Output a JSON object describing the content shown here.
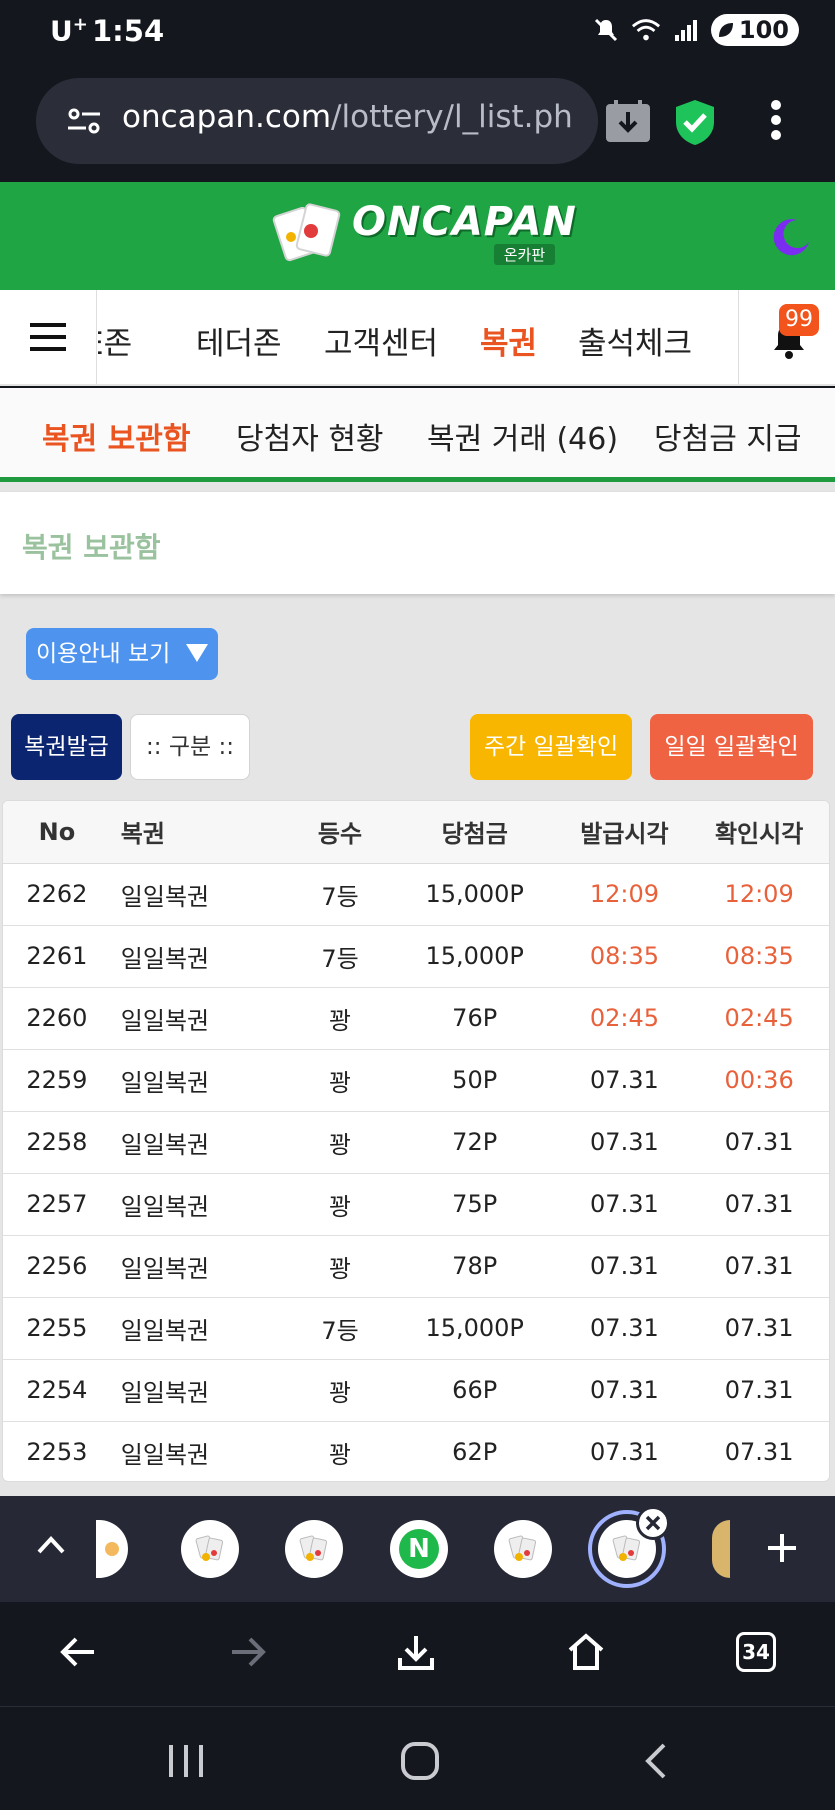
{
  "status_bar": {
    "carrier": "U",
    "carrier_sup": "+",
    "time": "1:54",
    "battery": "100"
  },
  "browser": {
    "url_host": "oncapan.com",
    "url_path": "/lottery/l_list.ph",
    "tab_count": "34"
  },
  "site": {
    "logo_text": "ONCAPAN",
    "logo_sub": "온카판"
  },
  "main_nav": {
    "items": [
      {
        "label": "E존"
      },
      {
        "label": "테더존"
      },
      {
        "label": "고객센터"
      },
      {
        "label": "복권"
      },
      {
        "label": "출석체크"
      }
    ],
    "active_index": 3,
    "notification_count": "99"
  },
  "sub_nav": {
    "items": [
      {
        "label": "복권 보관함"
      },
      {
        "label": "당첨자 현황"
      },
      {
        "label": "복권 거래 (46)"
      },
      {
        "label": "당첨금 지급"
      }
    ],
    "active_index": 0
  },
  "page": {
    "title": "복권 보관함",
    "guide_button": "이용안내 보기",
    "issue_button": "복권발급",
    "category_select": ":: 구분 ::",
    "weekly_check_button": "주간 일괄확인",
    "daily_check_button": "일일 일괄확인"
  },
  "table": {
    "headers": [
      "No",
      "복권",
      "등수",
      "당첨금",
      "발급시각",
      "확인시각"
    ],
    "rows": [
      {
        "no": "2262",
        "name": "일일복권",
        "rank": "7등",
        "prize": "15,000P",
        "issued": "12:09",
        "checked": "12:09"
      },
      {
        "no": "2261",
        "name": "일일복권",
        "rank": "7등",
        "prize": "15,000P",
        "issued": "08:35",
        "checked": "08:35"
      },
      {
        "no": "2260",
        "name": "일일복권",
        "rank": "꽝",
        "prize": "76P",
        "issued": "02:45",
        "checked": "02:45"
      },
      {
        "no": "2259",
        "name": "일일복권",
        "rank": "꽝",
        "prize": "50P",
        "issued": "07.31",
        "checked": "00:36"
      },
      {
        "no": "2258",
        "name": "일일복권",
        "rank": "꽝",
        "prize": "72P",
        "issued": "07.31",
        "checked": "07.31"
      },
      {
        "no": "2257",
        "name": "일일복권",
        "rank": "꽝",
        "prize": "75P",
        "issued": "07.31",
        "checked": "07.31"
      },
      {
        "no": "2256",
        "name": "일일복권",
        "rank": "꽝",
        "prize": "78P",
        "issued": "07.31",
        "checked": "07.31"
      },
      {
        "no": "2255",
        "name": "일일복권",
        "rank": "7등",
        "prize": "15,000P",
        "issued": "07.31",
        "checked": "07.31"
      },
      {
        "no": "2254",
        "name": "일일복권",
        "rank": "꽝",
        "prize": "66P",
        "issued": "07.31",
        "checked": "07.31"
      },
      {
        "no": "2253",
        "name": "일일복권",
        "rank": "꽝",
        "prize": "62P",
        "issued": "07.31",
        "checked": "07.31"
      }
    ]
  },
  "colors": {
    "brand_green": "#1fa543",
    "active_orange": "#ea5420",
    "issue_navy": "#0b2570",
    "weekly_yellow": "#f8b600",
    "daily_red": "#f06342",
    "time_orange": "#e8613a"
  },
  "icons": {
    "tab_strip": [
      "chevron-up-icon",
      "tab-favicon",
      "tab-favicon",
      "tab-favicon",
      "naver-favicon",
      "tab-favicon",
      "tab-favicon",
      "tab-favicon",
      "plus-icon"
    ],
    "naver_letter": "N"
  }
}
